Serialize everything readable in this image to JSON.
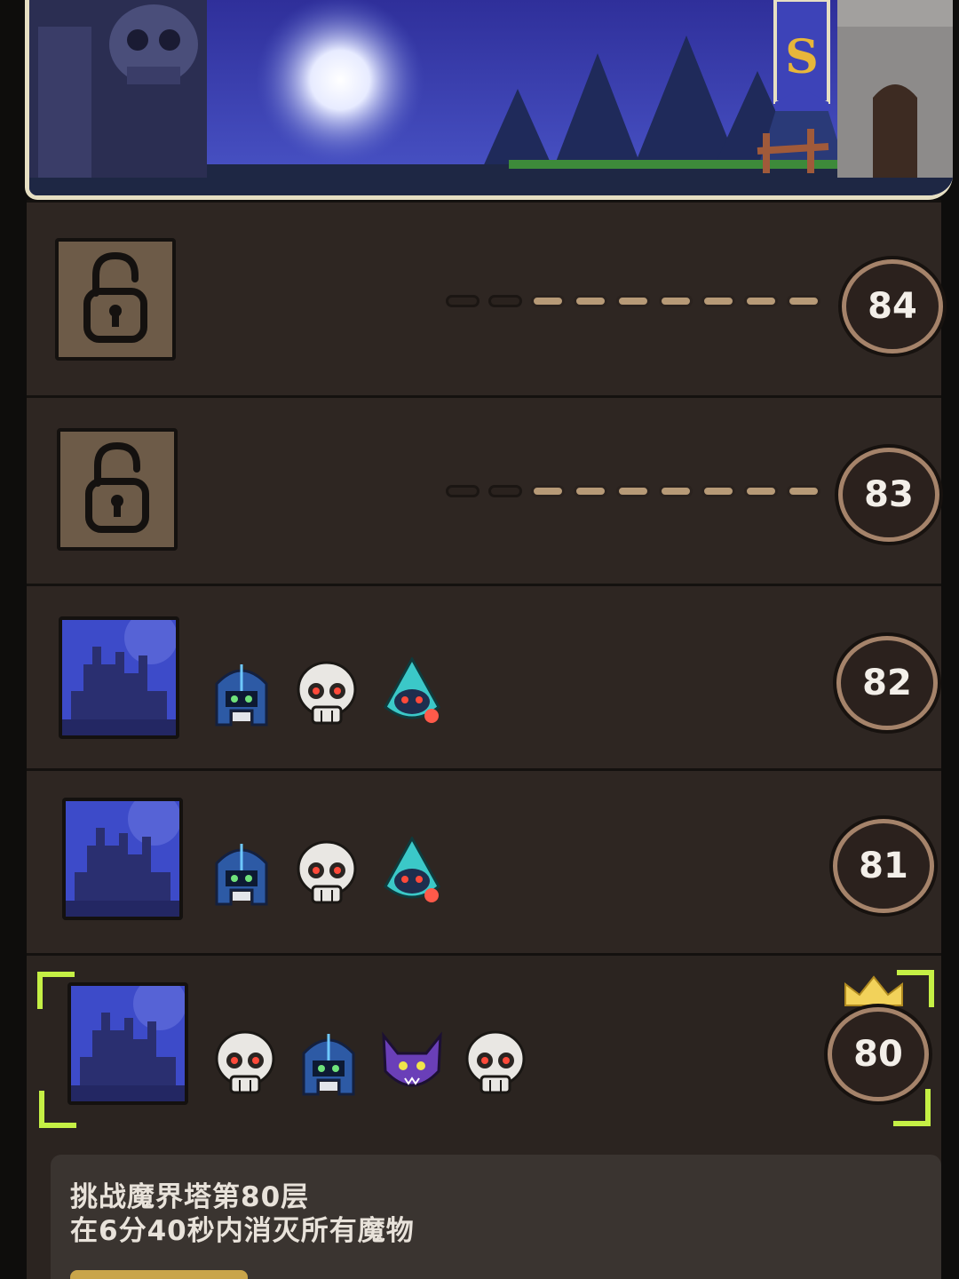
{
  "levels": [
    {
      "number": "84",
      "state": "locked",
      "progress": 0.8
    },
    {
      "number": "83",
      "state": "locked",
      "progress": 0.8
    },
    {
      "number": "82",
      "state": "unlocked",
      "monsters": [
        "armored-knight-icon",
        "skull-icon",
        "hooded-ghost-icon"
      ]
    },
    {
      "number": "81",
      "state": "unlocked",
      "monsters": [
        "armored-knight-icon",
        "skull-icon",
        "hooded-ghost-icon"
      ]
    },
    {
      "number": "80",
      "state": "selected",
      "best": true,
      "monsters": [
        "skull-icon",
        "armored-knight-icon",
        "bat-icon",
        "skull-icon"
      ]
    }
  ],
  "challenge": {
    "title": "挑战魔界塔第80层",
    "subtitle": "在6分40秒内消灭所有魔物"
  },
  "colors": {
    "selection": "#c5f045",
    "crown": "#f2d25a",
    "badge_ring": "#a5836a",
    "stage_thumb": "#3d4bc9"
  },
  "banner": {
    "flag_letter": "S"
  }
}
